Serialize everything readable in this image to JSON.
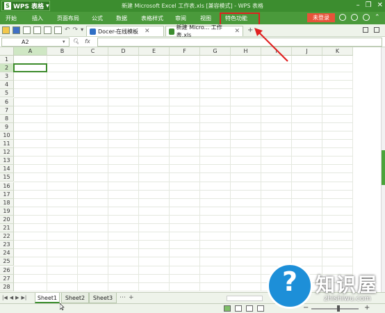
{
  "titlebar": {
    "app_label": "WPS 表格",
    "title": "新建 Microsoft Excel 工作表.xls [兼容模式] - WPS 表格"
  },
  "menubar": {
    "items": [
      "开始",
      "插入",
      "页面布局",
      "公式",
      "数据",
      "表格样式",
      "审阅",
      "视图",
      "特色功能"
    ],
    "login_label": "未登录"
  },
  "tabs": [
    {
      "label": "Docer-在线模板"
    },
    {
      "label": "新建 Micro... 工作表.xls"
    }
  ],
  "formula_bar": {
    "name_box": "A2",
    "formula": ""
  },
  "grid": {
    "columns": [
      "A",
      "B",
      "C",
      "D",
      "E",
      "F",
      "G",
      "H",
      "I",
      "J",
      "K"
    ],
    "rows": [
      "1",
      "2",
      "3",
      "4",
      "5",
      "6",
      "7",
      "8",
      "9",
      "10",
      "11",
      "12",
      "13",
      "14",
      "15",
      "16",
      "17",
      "18",
      "19",
      "20",
      "21",
      "22",
      "23",
      "24",
      "25",
      "26",
      "27",
      "28"
    ],
    "active_cell": "A2"
  },
  "sheets": [
    {
      "label": "Sheet1",
      "active": true
    },
    {
      "label": "Sheet2",
      "active": false
    },
    {
      "label": "Sheet3",
      "active": false
    }
  ],
  "watermark": {
    "title": "知识屋",
    "subtitle": "zhishiwu.com"
  },
  "colors": {
    "accent_green": "#3c8d2f",
    "highlight_red": "#e02020",
    "login_orange": "#e8533a"
  }
}
